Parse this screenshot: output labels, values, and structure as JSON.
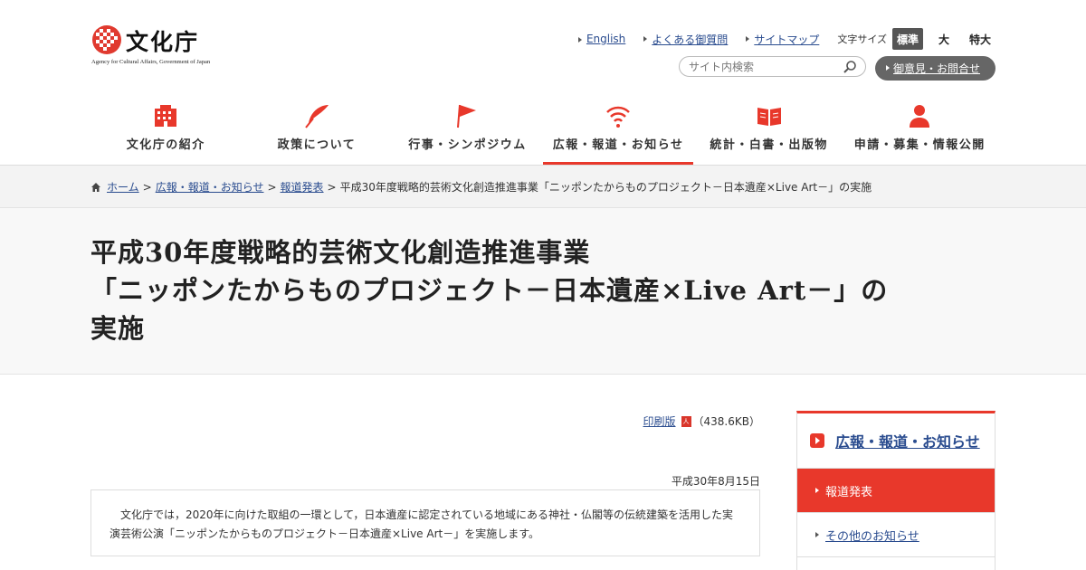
{
  "header": {
    "logo_text": "文化庁",
    "logo_sub": "Agency for Cultural Affairs, Government of Japan",
    "links": [
      "English",
      "よくある御質問",
      "サイトマップ"
    ],
    "font_size_label": "文字サイズ",
    "font_sizes": [
      "標準",
      "大",
      "特大"
    ],
    "font_size_selected": "標準",
    "search_placeholder": "サイト内検索",
    "opinion_label": "御意見・お問合せ"
  },
  "gnav": {
    "items": [
      {
        "label": "文化庁の紹介",
        "icon": "building-icon"
      },
      {
        "label": "政策について",
        "icon": "quill-icon"
      },
      {
        "label": "行事・シンポジウム",
        "icon": "flag-icon"
      },
      {
        "label": "広報・報道・お知らせ",
        "icon": "broadcast-icon"
      },
      {
        "label": "統計・白書・出版物",
        "icon": "book-icon"
      },
      {
        "label": "申請・募集・情報公開",
        "icon": "person-icon"
      }
    ],
    "active": "広報・報道・お知らせ",
    "accent_color": "#e8382b"
  },
  "breadcrumb": {
    "items": [
      "ホーム",
      "広報・報道・お知らせ",
      "報道発表"
    ],
    "current": "平成30年度戦略的芸術文化創造推進事業「ニッポンたからものプロジェクト－日本遺産×Live Art－」の実施",
    "separator": ">"
  },
  "page_title": {
    "line1": "平成30年度戦略的芸術文化創造推進事業",
    "line2": "「ニッポンたからものプロジェクト－日本遺産×Live Art－」の",
    "line3": "実施"
  },
  "main": {
    "print_label": "印刷版",
    "print_size": "（438.6KB）",
    "pdf_icon_text": "人",
    "date": "平成30年8月15日",
    "lead": "文化庁では，2020年に向けた取組の一環として，日本遺産に認定されている地域にある神社・仏閣等の伝統建築を活用した実演芸術公演「ニッポンたからものプロジェクト－日本遺産×Live Art－」を実施します。"
  },
  "side": {
    "heading": "広報・報道・お知らせ",
    "items": [
      "報道発表",
      "その他のお知らせ"
    ],
    "active": "報道発表"
  }
}
